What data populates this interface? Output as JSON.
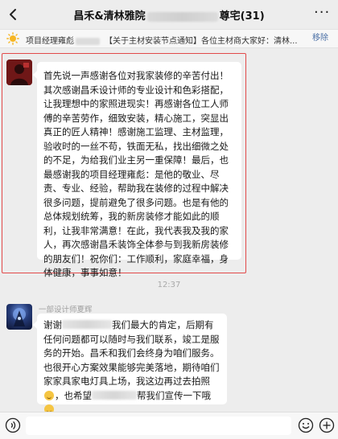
{
  "header": {
    "title_prefix": "昌禾&清林雅院",
    "title_suffix": "尊宅(31)"
  },
  "notice": {
    "text_a": "项目经理雍彪",
    "text_b": "【关于主材安装节点通知】各位主材商大家好：清林...",
    "fold_label": "移除"
  },
  "messages": [
    {
      "text": "首先说一声感谢各位对我家装修的辛苦付出！其次感谢昌禾设计师的专业设计和色彩搭配，让我理想中的家照进现实！再感谢各位工人师傅的辛苦劳作，细致安装，精心施工，突显出真正的匠人精神！感谢施工监理、主材监理，验收时的一丝不苟，铁面无私，找出细微之处的不足，为给我们业主另一重保障！最后，也最感谢我的项目经理雍彪：是他的敬业、尽责、专业、经验，帮助我在装修的过程中解决很多问题，提前避免了很多问题。也是有他的总体规划统筹，我的新房装修才能如此的顺利，让我非常满意！在此，我代表我及我的家人，再次感谢昌禾装饰全体参与到我新房装修的朋友们！祝你们：工作顺利，家庭幸福，身体健康，事事如意！"
    },
    {
      "sender": "一部设计师夏辉",
      "part1": "谢谢",
      "part2": "我们最大的肯定，后期有任何问题都可以随时与我们联系，竣工是服务的开始。昌禾和我们会终身为咱们服务。也很开心方案效果能够完美落地，期待咱们家家具家电灯具上场，我这边再过去拍照",
      "part3": "，也希望",
      "part4": "帮我们宣传一下哦"
    }
  ],
  "time_divider": "12:37",
  "input": {
    "value": ""
  },
  "icons": {
    "back": "chevron-left-icon",
    "more": "more-icon",
    "notice": "sun-icon",
    "voice": "voice-icon",
    "emoji": "emoji-icon",
    "add": "plus-icon"
  },
  "colors": {
    "highlight_border": "#e24a4a",
    "bubble": "#ffffff",
    "background": "#ededed"
  }
}
